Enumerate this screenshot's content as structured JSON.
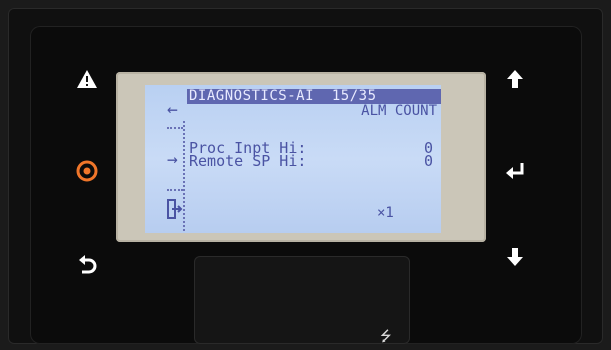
{
  "display": {
    "title": "DIAGNOSTICS-AI  15/35",
    "subtitle": "ALM COUNT",
    "rows": [
      {
        "label": "Proc Inpt Hi:",
        "value": "0"
      },
      {
        "label": "Remote SP Hi:",
        "value": "0"
      }
    ],
    "multiplier": "×1",
    "nav_back_glyph": "←",
    "nav_current_glyph": "→"
  },
  "buttons": {
    "alarm": {
      "icon": "warning-triangle-icon"
    },
    "home": {
      "icon": "target-circle-icon",
      "color": "#f0762a"
    },
    "back": {
      "icon": "undo-arrow-icon"
    },
    "up": {
      "icon": "arrow-up-icon"
    },
    "enter": {
      "icon": "enter-return-icon"
    },
    "down": {
      "icon": "arrow-down-icon"
    }
  },
  "colors": {
    "lcd_bg": "#c2d6f4",
    "lcd_text": "#4a53a3",
    "title_bar": "#5f67b0",
    "button_white": "#ffffff",
    "button_orange": "#f0762a"
  },
  "usb_icon": "usb-icon",
  "usb_glyph": "⭍"
}
